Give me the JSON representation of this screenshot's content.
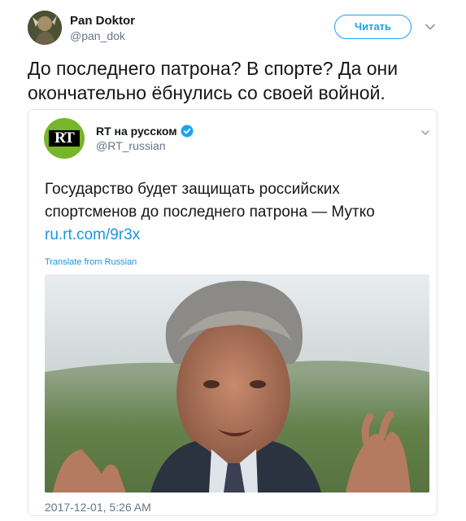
{
  "tweet": {
    "author_name": "Pan Doktor",
    "author_handle": "@pan_dok",
    "follow_label": "Читать",
    "text": "До последнего патрона? В спорте? Да они окончательно ёбнулись со своей войной."
  },
  "quoted": {
    "author_name": "RT на русском",
    "author_handle": "@RT_russian",
    "logo_text": "RT",
    "text": "Государство будет защищать российских спортсменов до последнего патрона — Мутко",
    "link": "ru.rt.com/9r3x",
    "translate_label": "Translate from Russian",
    "timestamp": "2017-12-01, 5:26 AM"
  },
  "colors": {
    "accent": "#1da1f2",
    "link": "#1b95e0",
    "rt_green": "#77b52b",
    "muted": "#657786"
  },
  "icons": [
    "chevron-down-icon",
    "verified-icon"
  ]
}
